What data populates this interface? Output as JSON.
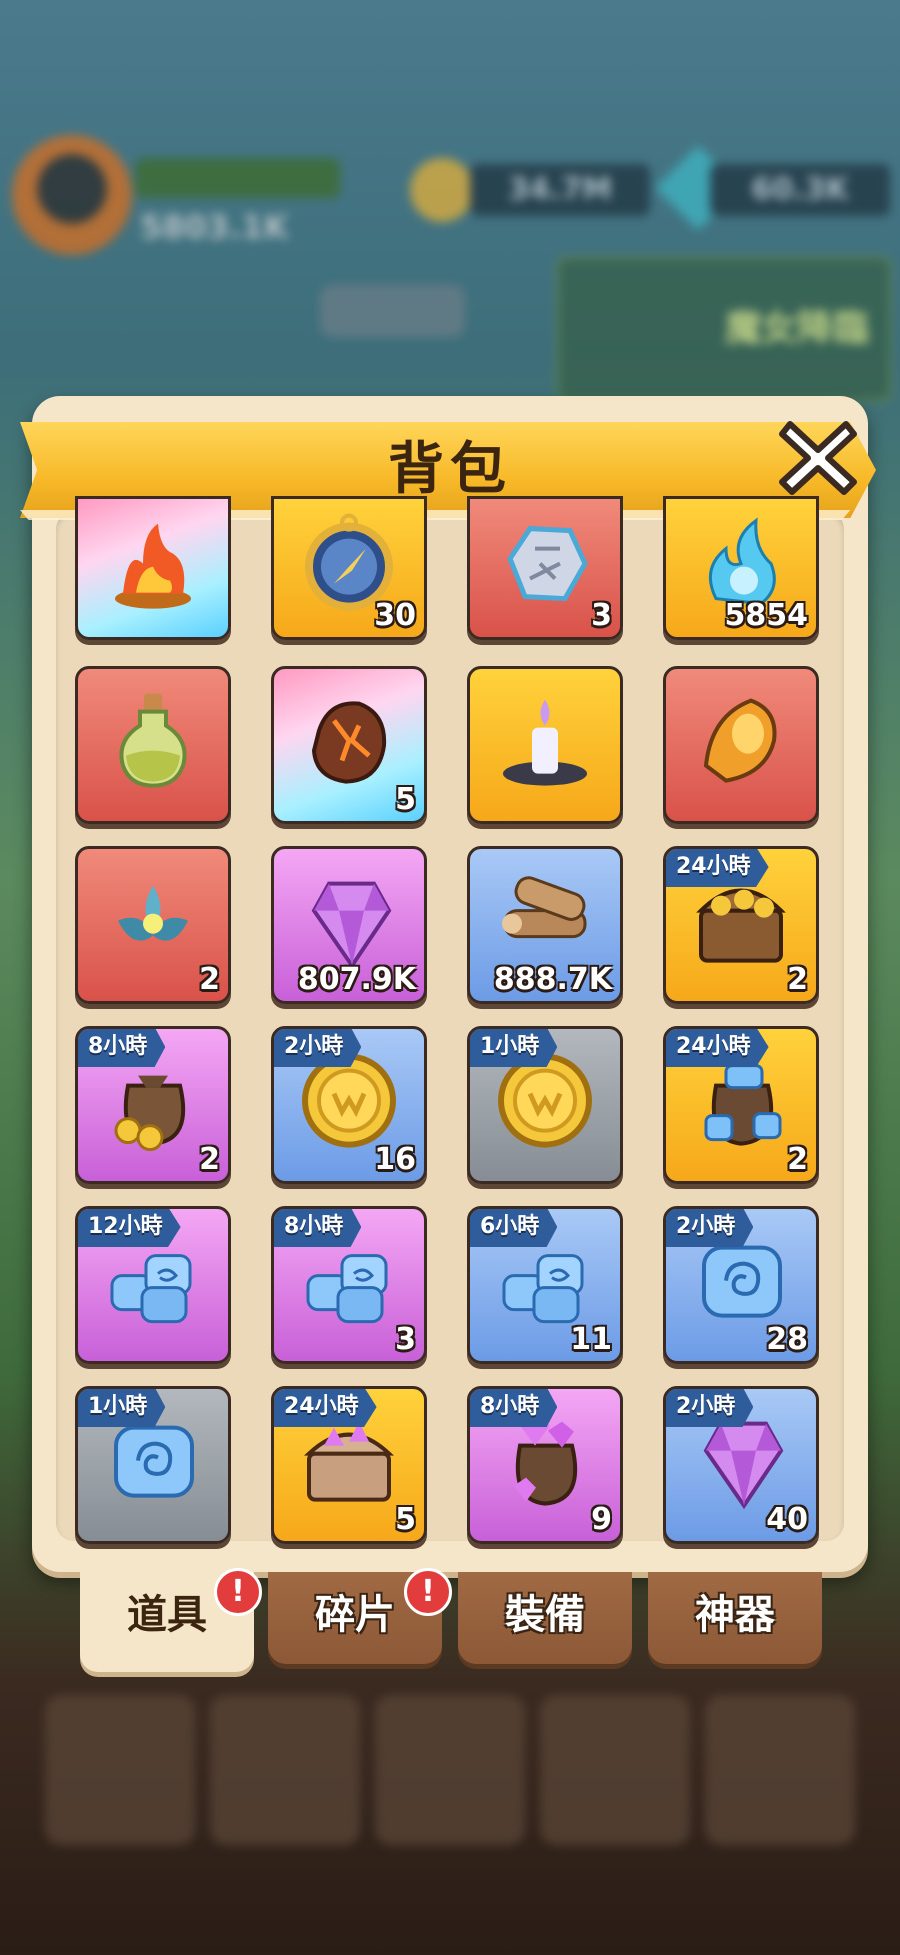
{
  "hud": {
    "power": "5803.1K",
    "coins": "34.7M",
    "gems": "60.3K",
    "banner_label": "魔女降臨"
  },
  "panel": {
    "title": "背包"
  },
  "items": [
    {
      "icon": "flame-brazier-icon",
      "rarity": "rainbow",
      "count": "",
      "timer": ""
    },
    {
      "icon": "compass-icon",
      "rarity": "orange",
      "count": "30",
      "timer": ""
    },
    {
      "icon": "rune-stone-icon",
      "rarity": "red",
      "count": "3",
      "timer": ""
    },
    {
      "icon": "blue-flame-icon",
      "rarity": "orange",
      "count": "5854",
      "timer": ""
    },
    {
      "icon": "potion-flask-icon",
      "rarity": "red",
      "count": "",
      "timer": ""
    },
    {
      "icon": "lava-rock-icon",
      "rarity": "rainbow",
      "count": "5",
      "timer": ""
    },
    {
      "icon": "candle-icon",
      "rarity": "orange",
      "count": "",
      "timer": ""
    },
    {
      "icon": "amber-horn-icon",
      "rarity": "red",
      "count": "",
      "timer": ""
    },
    {
      "icon": "lotus-icon",
      "rarity": "red",
      "count": "2",
      "timer": ""
    },
    {
      "icon": "purple-gem-icon",
      "rarity": "purple",
      "count": "807.9K",
      "timer": ""
    },
    {
      "icon": "wood-logs-icon",
      "rarity": "blue",
      "count": "888.7K",
      "timer": ""
    },
    {
      "icon": "gold-chest-icon",
      "rarity": "orange",
      "count": "2",
      "timer": "24小時"
    },
    {
      "icon": "gold-bag-icon",
      "rarity": "purple",
      "count": "2",
      "timer": "8小時"
    },
    {
      "icon": "gold-coin-icon",
      "rarity": "blue",
      "count": "16",
      "timer": "2小時"
    },
    {
      "icon": "gold-coin-icon",
      "rarity": "gray",
      "count": "",
      "timer": "1小時"
    },
    {
      "icon": "blue-stone-bag-icon",
      "rarity": "orange",
      "count": "2",
      "timer": "24小時"
    },
    {
      "icon": "blue-stones-icon",
      "rarity": "purple",
      "count": "",
      "timer": "12小時"
    },
    {
      "icon": "blue-stones-icon",
      "rarity": "purple",
      "count": "3",
      "timer": "8小時"
    },
    {
      "icon": "blue-stones-icon",
      "rarity": "blue",
      "count": "11",
      "timer": "6小時"
    },
    {
      "icon": "blue-stone-icon",
      "rarity": "blue",
      "count": "28",
      "timer": "2小時"
    },
    {
      "icon": "blue-stone-icon",
      "rarity": "gray",
      "count": "",
      "timer": "1小時"
    },
    {
      "icon": "purple-chest-icon",
      "rarity": "orange",
      "count": "5",
      "timer": "24小時"
    },
    {
      "icon": "purple-gem-bag-icon",
      "rarity": "purple",
      "count": "9",
      "timer": "8小時"
    },
    {
      "icon": "purple-gem-icon",
      "rarity": "blue",
      "count": "40",
      "timer": "2小時"
    }
  ],
  "tabs": [
    {
      "label": "道具",
      "active": true,
      "badge": "!"
    },
    {
      "label": "碎片",
      "active": false,
      "badge": "!"
    },
    {
      "label": "裝備",
      "active": false,
      "badge": ""
    },
    {
      "label": "神器",
      "active": false,
      "badge": ""
    }
  ],
  "colors": {
    "panel_bg": "#f6e6c9",
    "ribbon": "#f7b928",
    "timer_bg": "#2f5c9a",
    "badge": "#e23c3c"
  }
}
